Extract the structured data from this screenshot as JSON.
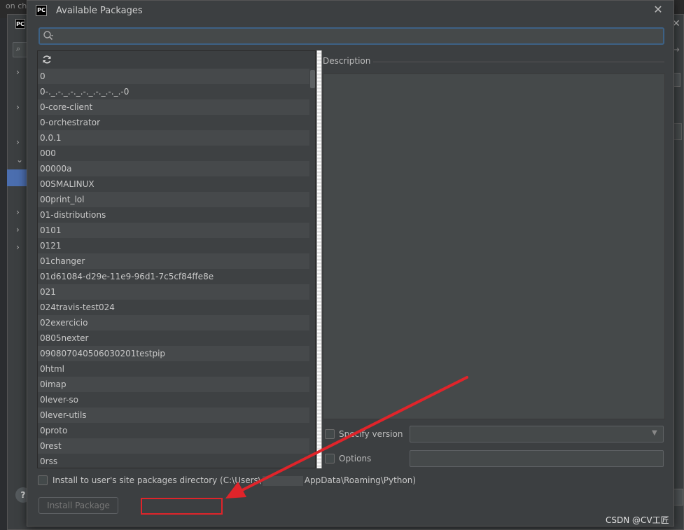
{
  "background": {
    "top_text": "on  che",
    "logo": "PC",
    "help_label": "?"
  },
  "dialog": {
    "logo": "PC",
    "title": "Available Packages",
    "close_label": "✕"
  },
  "search": {
    "value": "",
    "placeholder": ""
  },
  "packages": [
    "0",
    "0-._.-._.-._.-._.-._.-._.-0",
    "0-core-client",
    "0-orchestrator",
    "0.0.1",
    "000",
    "00000a",
    "00SMALINUX",
    "00print_lol",
    "01-distributions",
    "0101",
    "0121",
    "01changer",
    "01d61084-d29e-11e9-96d1-7c5cf84ffe8e",
    "021",
    "024travis-test024",
    "02exercicio",
    "0805nexter",
    "090807040506030201testpip",
    "0html",
    "0imap",
    "0lever-so",
    "0lever-utils",
    "0proto",
    "0rest",
    "0rss"
  ],
  "description": {
    "label": "Description",
    "text": ""
  },
  "specify_version": {
    "label": "Specify version",
    "checked": false,
    "selected": ""
  },
  "options": {
    "label": "Options",
    "checked": false,
    "value": ""
  },
  "install_user_site": {
    "label_prefix": "Install to user's site packages directory (C:\\Users\\",
    "label_suffix": "AppData\\Roaming\\Python)",
    "checked": false
  },
  "install_button": {
    "label": "Install Package",
    "enabled": false
  },
  "watermark": "CSDN @CV工匠",
  "colors": {
    "dialog_bg": "#3c3f41",
    "accent_border": "#3d6185",
    "annotation_red": "#e0242a"
  }
}
